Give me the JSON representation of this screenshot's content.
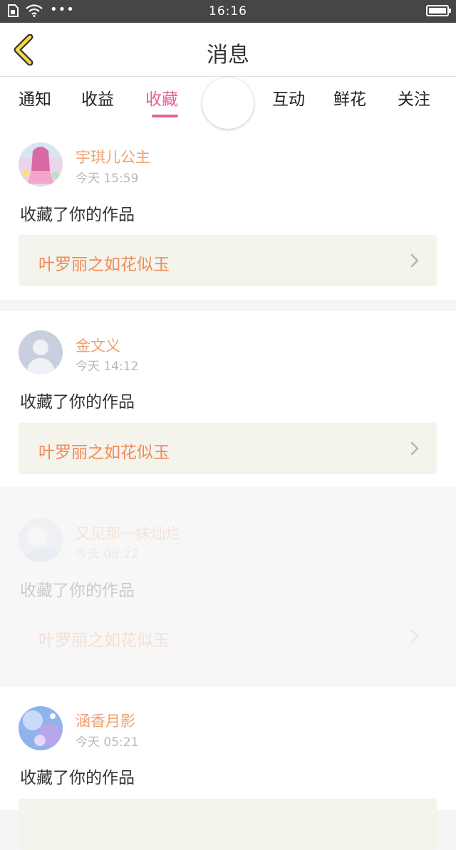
{
  "status_bar": {
    "time": "16:16",
    "dots": "•••"
  },
  "nav": {
    "title": "消息"
  },
  "tabs": [
    {
      "label": "通知"
    },
    {
      "label": "收益"
    },
    {
      "label": "收藏"
    },
    {
      "label": "互动"
    },
    {
      "label": "鲜花"
    },
    {
      "label": "关注"
    }
  ],
  "active_tab": "收藏",
  "messages": [
    {
      "user": "宇琪儿公主",
      "time": "今天 15:59",
      "action": "收藏了你的作品",
      "work": "叶罗丽之如花似玉"
    },
    {
      "user": "金文义",
      "time": "今天 14:12",
      "action": "收藏了你的作品",
      "work": "叶罗丽之如花似玉"
    },
    {
      "user": "又见那一抹灿烂",
      "time": "今天 08:22",
      "action": "收藏了你的作品",
      "work": "叶罗丽之如花似玉"
    },
    {
      "user": "涵香月影",
      "time": "今天 05:21",
      "action": "收藏了你的作品",
      "work": ""
    }
  ],
  "colors": {
    "accent": "#e8609a",
    "username": "#f0a070",
    "work_title": "#f08a55",
    "status_bar": "#464646"
  }
}
